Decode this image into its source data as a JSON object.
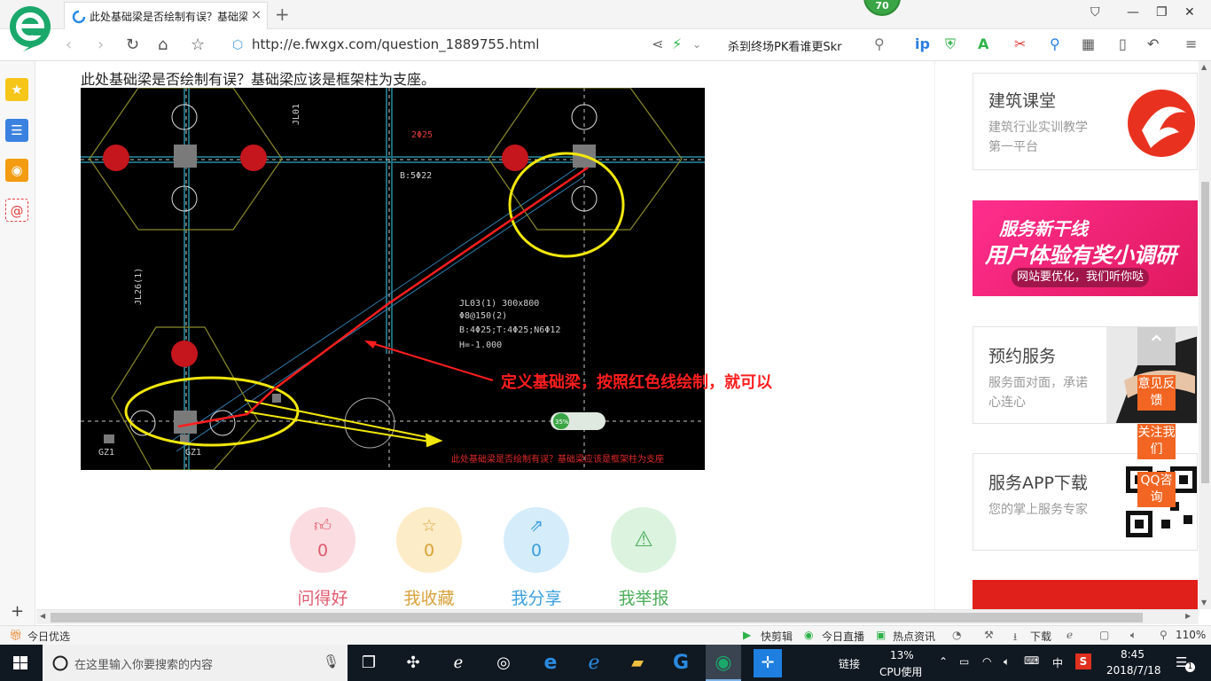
{
  "browser": {
    "tab_title": "此处基础梁是否绘制有误？基础梁",
    "tab_close": "×",
    "new_tab": "+",
    "badge": "70",
    "url": "http://e.fwxgx.com/question_1889755.html",
    "search_text": "杀到终场PK看谁更Skr"
  },
  "page": {
    "question_title": "此处基础梁是否绘制有误？基础梁应该是框架柱为支座。",
    "cad": {
      "label_beam": "JL03(1) 300x800",
      "label_stirrup": "Φ8@150(2)",
      "label_bars": "B:4Φ25;T:4Φ25;N6Φ12",
      "label_h": "H=-1.000",
      "label_b5": "B:5Φ22",
      "label_2": "2Φ25",
      "label_jl26": "JL26(1)",
      "label_jl01": "JL01",
      "label_gz1a": "GZ1",
      "label_gz1b": "GZ1",
      "annotation": "定义基础梁，按照红色线绘制，就可以",
      "footer_caption": "此处基础梁是否绘制有误？基础梁应该是框架柱为支座",
      "zoom_badge": "35%"
    },
    "actions": [
      {
        "icon": "thumbs-up-icon",
        "count": "0",
        "label": "问得好",
        "color": "#e05a6e",
        "bg": "#fbdde1"
      },
      {
        "icon": "star-icon",
        "count": "0",
        "label": "我收藏",
        "color": "#d9a23a",
        "bg": "#fdecc8"
      },
      {
        "icon": "share-icon",
        "count": "0",
        "label": "我分享",
        "color": "#3a9fe0",
        "bg": "#d5ecfb"
      },
      {
        "icon": "warning-icon",
        "count": "",
        "label": "我举报",
        "color": "#4cae5a",
        "bg": "#dcf3e0"
      }
    ]
  },
  "sidebar": {
    "cards": [
      {
        "title": "建筑课堂",
        "sub": "建筑行业实训教学第一平台"
      },
      {
        "banner_line1": "服务新干线",
        "banner_line2": "用户体验有奖小调研",
        "banner_line3": "网站要优化，我们听你哒"
      },
      {
        "title": "预约服务",
        "sub": "服务面对面，承诺心连心"
      },
      {
        "title": "服务APP下载",
        "sub": "您的掌上服务专家"
      }
    ],
    "float_buttons": [
      "意见反馈",
      "关注我们",
      "QQ咨询"
    ]
  },
  "statusbar": {
    "left": "今日优选",
    "items": [
      "快剪辑",
      "今日直播",
      "热点资讯",
      "下载"
    ],
    "zoom": "110%"
  },
  "taskbar": {
    "search_placeholder": "在这里输入你要搜索的内容",
    "link_label": "链接",
    "cpu_percent": "13%",
    "cpu_label": "CPU使用",
    "ime": "中",
    "time": "8:45",
    "date": "2018/7/18",
    "notifications": "1"
  }
}
